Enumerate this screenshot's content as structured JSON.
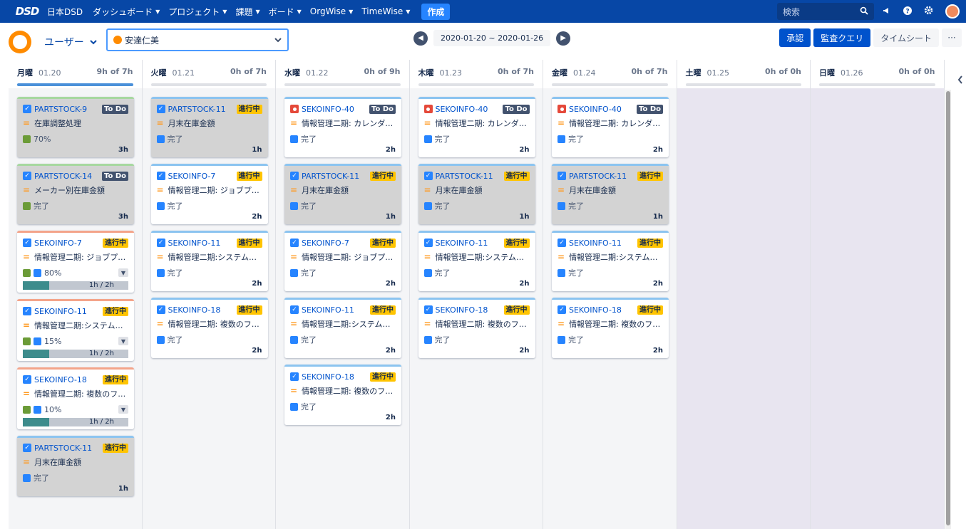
{
  "nav": {
    "logo": "DSD",
    "brand": "日本DSD",
    "items": [
      "ダッシュボード",
      "プロジェクト",
      "課題",
      "ボード",
      "OrgWise",
      "TimeWise"
    ],
    "create": "作成",
    "search_placeholder": "検索"
  },
  "header": {
    "user_label": "ユーザー",
    "selected_user": "安達仁美",
    "date_range": "2020-01-20 ~ 2020-01-26",
    "approve": "承認",
    "audit_query": "監査クエリ",
    "timesheet": "タイムシート",
    "more": "···"
  },
  "columns": [
    {
      "day": "月曜",
      "date": "01.20",
      "hours": "9h of 7h",
      "bar_fill": 1.0,
      "cards": [
        {
          "key": "PARTSTOCK-9",
          "type": "task",
          "status": "To Do",
          "summary": "在庫調整処理",
          "meta": "70%",
          "meta_icon": "pen",
          "hours": "3h",
          "grey": true,
          "top": "green"
        },
        {
          "key": "PARTSTOCK-14",
          "type": "task",
          "status": "To Do",
          "summary": "メーカー別在庫金額",
          "meta": "完了",
          "meta_icon": "pen",
          "hours": "3h",
          "grey": true,
          "top": "green"
        },
        {
          "key": "SEKOINFO-7",
          "type": "task",
          "status": "進行中",
          "summary": "情報管理二期: ジョブプ…",
          "meta": "80%",
          "meta_icon": "both",
          "progress": "1h / 2h",
          "progress_fraction": 0.5,
          "top": "orange"
        },
        {
          "key": "SEKOINFO-11",
          "type": "task",
          "status": "進行中",
          "summary": "情報管理二期:システム…",
          "meta": "15%",
          "meta_icon": "both",
          "progress": "1h / 2h",
          "progress_fraction": 0.5,
          "top": "orange"
        },
        {
          "key": "SEKOINFO-18",
          "type": "task",
          "status": "進行中",
          "summary": "情報管理二期: 複数のフ…",
          "meta": "10%",
          "meta_icon": "both",
          "progress": "1h / 2h",
          "progress_fraction": 0.5,
          "top": "orange"
        },
        {
          "key": "PARTSTOCK-11",
          "type": "task",
          "status": "進行中",
          "summary": "月末在庫金額",
          "meta": "完了",
          "meta_icon": "story",
          "hours": "1h",
          "grey": true,
          "top": "blue"
        }
      ]
    },
    {
      "day": "火曜",
      "date": "01.21",
      "hours": "0h of 7h",
      "bar_fill": 0,
      "cards": [
        {
          "key": "PARTSTOCK-11",
          "type": "task",
          "status": "進行中",
          "summary": "月末在庫金額",
          "meta": "完了",
          "meta_icon": "story",
          "hours": "1h",
          "grey": true,
          "top": "blue"
        },
        {
          "key": "SEKOINFO-7",
          "type": "task",
          "status": "進行中",
          "summary": "情報管理二期: ジョブプ…",
          "meta": "完了",
          "meta_icon": "story",
          "hours": "2h",
          "top": "blue"
        },
        {
          "key": "SEKOINFO-11",
          "type": "task",
          "status": "進行中",
          "summary": "情報管理二期:システム…",
          "meta": "完了",
          "meta_icon": "story",
          "hours": "2h",
          "top": "blue"
        },
        {
          "key": "SEKOINFO-18",
          "type": "task",
          "status": "進行中",
          "summary": "情報管理二期: 複数のフ…",
          "meta": "完了",
          "meta_icon": "story",
          "hours": "2h",
          "top": "blue"
        }
      ]
    },
    {
      "day": "水曜",
      "date": "01.22",
      "hours": "0h of 9h",
      "bar_fill": 0,
      "cards": [
        {
          "key": "SEKOINFO-40",
          "type": "bug",
          "status": "To Do",
          "summary": "情報管理二期: カレンダ…",
          "meta": "完了",
          "meta_icon": "story",
          "hours": "2h",
          "top": "blue"
        },
        {
          "key": "PARTSTOCK-11",
          "type": "task",
          "status": "進行中",
          "summary": "月末在庫金額",
          "meta": "完了",
          "meta_icon": "story",
          "hours": "1h",
          "grey": true,
          "top": "blue"
        },
        {
          "key": "SEKOINFO-7",
          "type": "task",
          "status": "進行中",
          "summary": "情報管理二期: ジョブプ…",
          "meta": "完了",
          "meta_icon": "story",
          "hours": "2h",
          "top": "blue"
        },
        {
          "key": "SEKOINFO-11",
          "type": "task",
          "status": "進行中",
          "summary": "情報管理二期:システム…",
          "meta": "完了",
          "meta_icon": "story",
          "hours": "2h",
          "top": "blue"
        },
        {
          "key": "SEKOINFO-18",
          "type": "task",
          "status": "進行中",
          "summary": "情報管理二期: 複数のフ…",
          "meta": "完了",
          "meta_icon": "story",
          "hours": "2h",
          "top": "blue"
        }
      ]
    },
    {
      "day": "木曜",
      "date": "01.23",
      "hours": "0h of 7h",
      "bar_fill": 0,
      "cards": [
        {
          "key": "SEKOINFO-40",
          "type": "bug",
          "status": "To Do",
          "summary": "情報管理二期: カレンダ…",
          "meta": "完了",
          "meta_icon": "story",
          "hours": "2h",
          "top": "blue"
        },
        {
          "key": "PARTSTOCK-11",
          "type": "task",
          "status": "進行中",
          "summary": "月末在庫金額",
          "meta": "完了",
          "meta_icon": "story",
          "hours": "1h",
          "grey": true,
          "top": "blue"
        },
        {
          "key": "SEKOINFO-11",
          "type": "task",
          "status": "進行中",
          "summary": "情報管理二期:システム…",
          "meta": "完了",
          "meta_icon": "story",
          "hours": "2h",
          "top": "blue"
        },
        {
          "key": "SEKOINFO-18",
          "type": "task",
          "status": "進行中",
          "summary": "情報管理二期: 複数のフ…",
          "meta": "完了",
          "meta_icon": "story",
          "hours": "2h",
          "top": "blue"
        }
      ]
    },
    {
      "day": "金曜",
      "date": "01.24",
      "hours": "0h of 7h",
      "bar_fill": 0,
      "cards": [
        {
          "key": "SEKOINFO-40",
          "type": "bug",
          "status": "To Do",
          "summary": "情報管理二期: カレンダ…",
          "meta": "完了",
          "meta_icon": "story",
          "hours": "2h",
          "top": "blue"
        },
        {
          "key": "PARTSTOCK-11",
          "type": "task",
          "status": "進行中",
          "summary": "月末在庫金額",
          "meta": "完了",
          "meta_icon": "story",
          "hours": "1h",
          "grey": true,
          "top": "blue"
        },
        {
          "key": "SEKOINFO-11",
          "type": "task",
          "status": "進行中",
          "summary": "情報管理二期:システム…",
          "meta": "完了",
          "meta_icon": "story",
          "hours": "2h",
          "top": "blue"
        },
        {
          "key": "SEKOINFO-18",
          "type": "task",
          "status": "進行中",
          "summary": "情報管理二期: 複数のフ…",
          "meta": "完了",
          "meta_icon": "story",
          "hours": "2h",
          "top": "blue"
        }
      ]
    },
    {
      "day": "土曜",
      "date": "01.25",
      "hours": "0h of 0h",
      "bar_fill": 0,
      "weekend": true,
      "cards": []
    },
    {
      "day": "日曜",
      "date": "01.26",
      "hours": "0h of 0h",
      "bar_fill": 0,
      "weekend": true,
      "cards": []
    }
  ]
}
